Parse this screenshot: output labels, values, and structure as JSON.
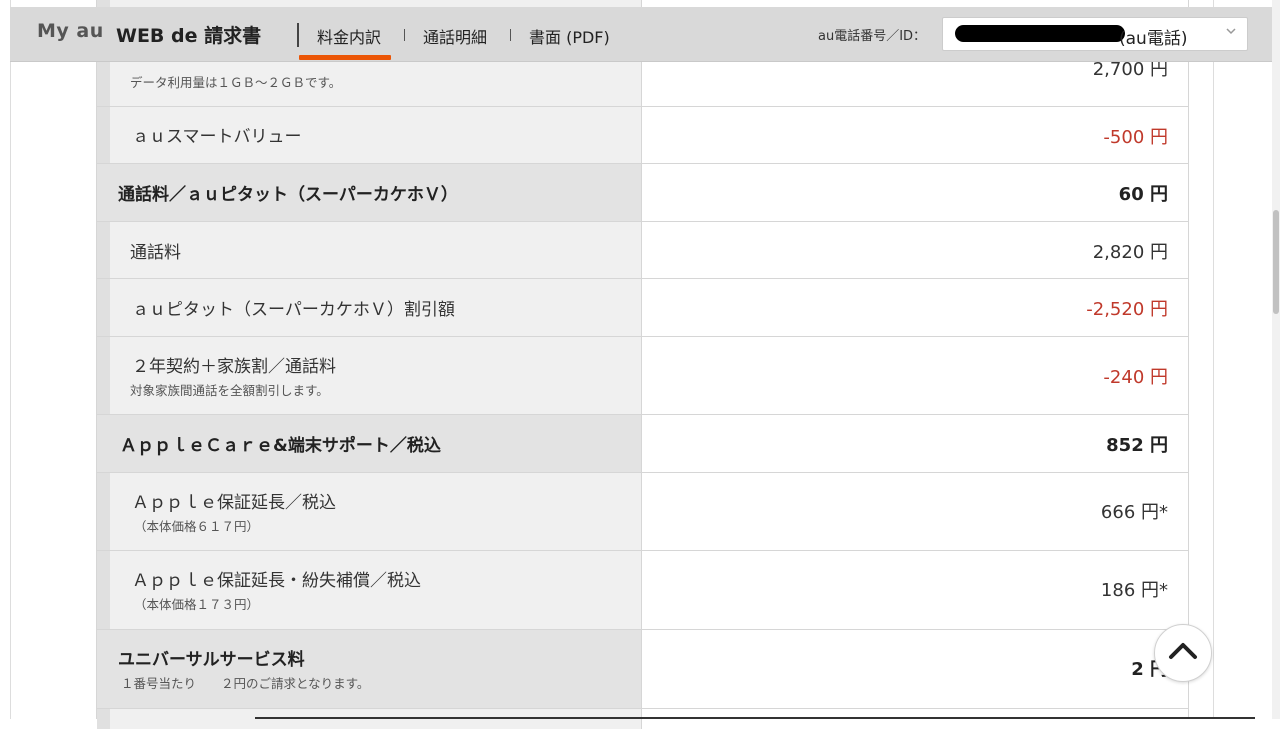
{
  "header": {
    "brand_myau": "My au",
    "brand_title": "WEB de 請求書",
    "nav": [
      {
        "label": "料金内訳",
        "active": true
      },
      {
        "label": "通話明細",
        "active": false
      },
      {
        "label": "書面 (PDF)",
        "active": false
      }
    ],
    "id_label": "au電話番号／ID：",
    "id_suffix": "(au電話)",
    "accent_color": "#eb5505"
  },
  "rows": [
    {
      "type": "sub",
      "label": "",
      "note": "データ利用量は１ＧＢ～２ＧＢです。",
      "value": "2,700 円"
    },
    {
      "type": "sub",
      "label": "ａｕスマートバリュー",
      "note": "",
      "value": "-500 円",
      "negative": true
    },
    {
      "type": "section",
      "label": "通話料／ａｕピタット（スーパーカケホＶ）",
      "note": "",
      "value": "60 円"
    },
    {
      "type": "sub",
      "label": "通話料",
      "note": "",
      "value": "2,820 円"
    },
    {
      "type": "sub",
      "label": "ａｕピタット（スーパーカケホＶ）割引額",
      "note": "",
      "value": "-2,520 円",
      "negative": true
    },
    {
      "type": "sub",
      "label": "２年契約＋家族割／通話料",
      "note": "対象家族間通話を全額割引します。",
      "value": "-240 円",
      "negative": true
    },
    {
      "type": "section",
      "label": "ＡｐｐｌｅＣａｒｅ&端末サポート／税込",
      "note": "",
      "value": "852 円"
    },
    {
      "type": "sub",
      "label": "Ａｐｐｌｅ保証延長／税込",
      "note": "（本体価格６１７円）",
      "value": "666 円*"
    },
    {
      "type": "sub",
      "label": "Ａｐｐｌｅ保証延長・紛失補償／税込",
      "note": "（本体価格１７３円）",
      "value": "186 円*"
    },
    {
      "type": "section",
      "label": "ユニバーサルサービス料",
      "note": "１番号当たり　　２円のご請求となります。",
      "value": "2 円"
    }
  ]
}
